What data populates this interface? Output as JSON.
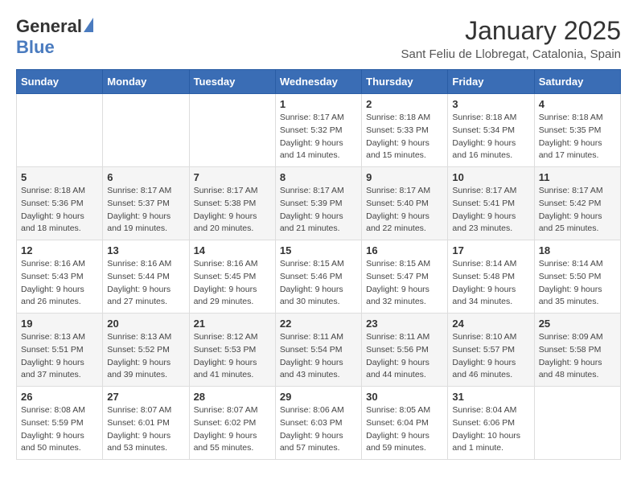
{
  "logo": {
    "general": "General",
    "blue": "Blue"
  },
  "title": "January 2025",
  "subtitle": "Sant Feliu de Llobregat, Catalonia, Spain",
  "headers": [
    "Sunday",
    "Monday",
    "Tuesday",
    "Wednesday",
    "Thursday",
    "Friday",
    "Saturday"
  ],
  "weeks": [
    [
      {
        "day": "",
        "info": ""
      },
      {
        "day": "",
        "info": ""
      },
      {
        "day": "",
        "info": ""
      },
      {
        "day": "1",
        "info": "Sunrise: 8:17 AM\nSunset: 5:32 PM\nDaylight: 9 hours\nand 14 minutes."
      },
      {
        "day": "2",
        "info": "Sunrise: 8:18 AM\nSunset: 5:33 PM\nDaylight: 9 hours\nand 15 minutes."
      },
      {
        "day": "3",
        "info": "Sunrise: 8:18 AM\nSunset: 5:34 PM\nDaylight: 9 hours\nand 16 minutes."
      },
      {
        "day": "4",
        "info": "Sunrise: 8:18 AM\nSunset: 5:35 PM\nDaylight: 9 hours\nand 17 minutes."
      }
    ],
    [
      {
        "day": "5",
        "info": "Sunrise: 8:18 AM\nSunset: 5:36 PM\nDaylight: 9 hours\nand 18 minutes."
      },
      {
        "day": "6",
        "info": "Sunrise: 8:17 AM\nSunset: 5:37 PM\nDaylight: 9 hours\nand 19 minutes."
      },
      {
        "day": "7",
        "info": "Sunrise: 8:17 AM\nSunset: 5:38 PM\nDaylight: 9 hours\nand 20 minutes."
      },
      {
        "day": "8",
        "info": "Sunrise: 8:17 AM\nSunset: 5:39 PM\nDaylight: 9 hours\nand 21 minutes."
      },
      {
        "day": "9",
        "info": "Sunrise: 8:17 AM\nSunset: 5:40 PM\nDaylight: 9 hours\nand 22 minutes."
      },
      {
        "day": "10",
        "info": "Sunrise: 8:17 AM\nSunset: 5:41 PM\nDaylight: 9 hours\nand 23 minutes."
      },
      {
        "day": "11",
        "info": "Sunrise: 8:17 AM\nSunset: 5:42 PM\nDaylight: 9 hours\nand 25 minutes."
      }
    ],
    [
      {
        "day": "12",
        "info": "Sunrise: 8:16 AM\nSunset: 5:43 PM\nDaylight: 9 hours\nand 26 minutes."
      },
      {
        "day": "13",
        "info": "Sunrise: 8:16 AM\nSunset: 5:44 PM\nDaylight: 9 hours\nand 27 minutes."
      },
      {
        "day": "14",
        "info": "Sunrise: 8:16 AM\nSunset: 5:45 PM\nDaylight: 9 hours\nand 29 minutes."
      },
      {
        "day": "15",
        "info": "Sunrise: 8:15 AM\nSunset: 5:46 PM\nDaylight: 9 hours\nand 30 minutes."
      },
      {
        "day": "16",
        "info": "Sunrise: 8:15 AM\nSunset: 5:47 PM\nDaylight: 9 hours\nand 32 minutes."
      },
      {
        "day": "17",
        "info": "Sunrise: 8:14 AM\nSunset: 5:48 PM\nDaylight: 9 hours\nand 34 minutes."
      },
      {
        "day": "18",
        "info": "Sunrise: 8:14 AM\nSunset: 5:50 PM\nDaylight: 9 hours\nand 35 minutes."
      }
    ],
    [
      {
        "day": "19",
        "info": "Sunrise: 8:13 AM\nSunset: 5:51 PM\nDaylight: 9 hours\nand 37 minutes."
      },
      {
        "day": "20",
        "info": "Sunrise: 8:13 AM\nSunset: 5:52 PM\nDaylight: 9 hours\nand 39 minutes."
      },
      {
        "day": "21",
        "info": "Sunrise: 8:12 AM\nSunset: 5:53 PM\nDaylight: 9 hours\nand 41 minutes."
      },
      {
        "day": "22",
        "info": "Sunrise: 8:11 AM\nSunset: 5:54 PM\nDaylight: 9 hours\nand 43 minutes."
      },
      {
        "day": "23",
        "info": "Sunrise: 8:11 AM\nSunset: 5:56 PM\nDaylight: 9 hours\nand 44 minutes."
      },
      {
        "day": "24",
        "info": "Sunrise: 8:10 AM\nSunset: 5:57 PM\nDaylight: 9 hours\nand 46 minutes."
      },
      {
        "day": "25",
        "info": "Sunrise: 8:09 AM\nSunset: 5:58 PM\nDaylight: 9 hours\nand 48 minutes."
      }
    ],
    [
      {
        "day": "26",
        "info": "Sunrise: 8:08 AM\nSunset: 5:59 PM\nDaylight: 9 hours\nand 50 minutes."
      },
      {
        "day": "27",
        "info": "Sunrise: 8:07 AM\nSunset: 6:01 PM\nDaylight: 9 hours\nand 53 minutes."
      },
      {
        "day": "28",
        "info": "Sunrise: 8:07 AM\nSunset: 6:02 PM\nDaylight: 9 hours\nand 55 minutes."
      },
      {
        "day": "29",
        "info": "Sunrise: 8:06 AM\nSunset: 6:03 PM\nDaylight: 9 hours\nand 57 minutes."
      },
      {
        "day": "30",
        "info": "Sunrise: 8:05 AM\nSunset: 6:04 PM\nDaylight: 9 hours\nand 59 minutes."
      },
      {
        "day": "31",
        "info": "Sunrise: 8:04 AM\nSunset: 6:06 PM\nDaylight: 10 hours\nand 1 minute."
      },
      {
        "day": "",
        "info": ""
      }
    ]
  ]
}
